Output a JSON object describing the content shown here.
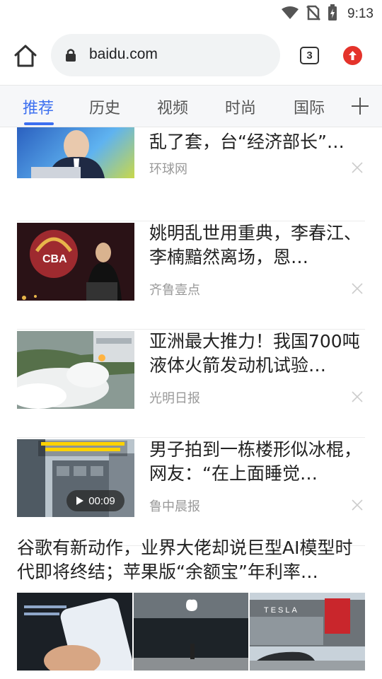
{
  "status_bar": {
    "time": "9:13",
    "icons": [
      "wifi-icon",
      "no-sim-icon",
      "battery-charging-icon"
    ]
  },
  "toolbar": {
    "url": "baidu.com",
    "tab_count": "3"
  },
  "channels": {
    "items": [
      "推荐",
      "历史",
      "视频",
      "时尚",
      "国际"
    ],
    "active": "推荐"
  },
  "feed": {
    "items": [
      {
        "title": "台前“亚安”：拜登、郁化乱了套，台“经济部长”…",
        "title_visible": "台前“亚安”：拜登、郁化\n乱了套，台“经济部长”…",
        "source": "环球网"
      },
      {
        "title": "姚明乱世用重典，李春江、李楠黯然离场，恩…",
        "source": "齐鲁壹点"
      },
      {
        "title": "亚洲最大推力！我国700吨液体火箭发动机试验…",
        "source": "光明日报"
      },
      {
        "title": "男子拍到一栋楼形似冰棍，网友：“在上面睡觉…",
        "source": "鲁中晨报",
        "video_duration": "00:09"
      }
    ],
    "big_item": {
      "title": "谷歌有新动作，业界大佬却说巨型AI模型时代即将终结；苹果版“余额宝”年利率…"
    }
  },
  "colors": {
    "accent": "#3c6ff0",
    "update_red": "#e4332b"
  }
}
